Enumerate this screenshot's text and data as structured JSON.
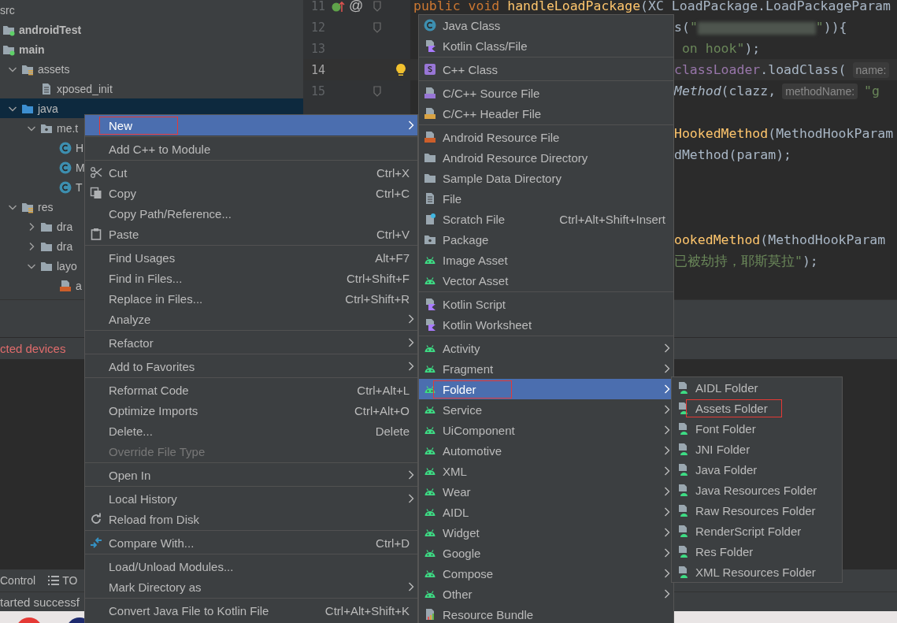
{
  "project_tree": [
    {
      "label": "src",
      "selected": false,
      "children": [
        {
          "label": "androidTest",
          "kind": "module-folder",
          "bold": true,
          "selected": false
        },
        {
          "label": "main",
          "kind": "module-folder",
          "bold": true,
          "selected": false,
          "children": [
            {
              "label": "assets",
              "kind": "resource-folder",
              "expanded": true,
              "selected": false,
              "children": [
                {
                  "label": "xposed_init",
                  "kind": "file",
                  "selected": false
                }
              ]
            },
            {
              "label": "java",
              "kind": "source-folder",
              "expanded": true,
              "selected": true,
              "children": [
                {
                  "label": "me.t",
                  "kind": "package",
                  "expanded": true,
                  "selected": false,
                  "children": [
                    {
                      "label": "H",
                      "kind": "class",
                      "selected": false
                    },
                    {
                      "label": "M",
                      "kind": "class",
                      "selected": false
                    },
                    {
                      "label": "T",
                      "kind": "class",
                      "selected": false
                    }
                  ]
                }
              ]
            },
            {
              "label": "res",
              "kind": "resource-folder",
              "expanded": true,
              "selected": false,
              "children": [
                {
                  "label": "dra",
                  "kind": "folder",
                  "expanded": false,
                  "selected": false
                },
                {
                  "label": "dra",
                  "kind": "folder",
                  "expanded": false,
                  "selected": false
                },
                {
                  "label": "layo",
                  "kind": "folder",
                  "expanded": true,
                  "selected": false,
                  "children": [
                    {
                      "label": "a",
                      "kind": "layout-file",
                      "selected": false
                    }
                  ]
                }
              ]
            }
          ]
        }
      ]
    }
  ],
  "editor": {
    "lines": [
      {
        "kind": "code",
        "number": "11",
        "override_marker": true,
        "gutter_mark": "@",
        "fold": true,
        "segments": [
          {
            "kind": "keyword",
            "text": "public void "
          },
          {
            "kind": "method",
            "text": "handleLoadPackage"
          },
          {
            "kind": "plain",
            "text": "(XC LoadPackage.LoadPackageParam"
          }
        ]
      },
      {
        "kind": "code",
        "number": "12",
        "fold": true,
        "covered": true,
        "segments": [
          {
            "kind": "plain",
            "text": "s("
          },
          {
            "kind": "string",
            "text": "\""
          },
          {
            "kind": "redacted"
          },
          {
            "kind": "string",
            "text": "\""
          },
          {
            "kind": "plain",
            "text": ")){"
          }
        ]
      },
      {
        "kind": "code",
        "number": "13",
        "covered": true,
        "segments": [
          {
            "kind": "string",
            "text": " on hook\""
          },
          {
            "kind": "plain",
            "text": ");"
          }
        ]
      },
      {
        "kind": "code",
        "number": "14",
        "current": true,
        "bulb": true,
        "covered": true,
        "segments": [
          {
            "kind": "field",
            "text": "classLoader"
          },
          {
            "kind": "plain",
            "text": ".loadClass("
          },
          {
            "kind": "hint",
            "text": "name:"
          }
        ]
      },
      {
        "kind": "code",
        "number": "15",
        "fold": true,
        "covered": true,
        "segments": [
          {
            "kind": "italic",
            "text": "Method"
          },
          {
            "kind": "plain",
            "text": "(clazz,"
          },
          {
            "kind": "hint",
            "text": "methodName:"
          },
          {
            "kind": "string",
            "text": "\"g"
          }
        ]
      },
      {
        "kind": "blank"
      },
      {
        "kind": "code",
        "covered": true,
        "segments": [
          {
            "kind": "method",
            "text": "HookedMethod"
          },
          {
            "kind": "plain",
            "text": "(MethodHookParam"
          }
        ]
      },
      {
        "kind": "code",
        "covered": true,
        "segments": [
          {
            "kind": "plain",
            "text": "dMethod(param);"
          }
        ]
      },
      {
        "kind": "blank"
      },
      {
        "kind": "blank"
      },
      {
        "kind": "blank"
      },
      {
        "kind": "code",
        "covered": true,
        "segments": [
          {
            "kind": "method",
            "text": "ookedMethod"
          },
          {
            "kind": "plain",
            "text": "(MethodHookParam"
          }
        ]
      },
      {
        "kind": "code",
        "covered": true,
        "segments": [
          {
            "kind": "string",
            "text": "已被劫持，耶斯莫拉\""
          },
          {
            "kind": "plain",
            "text": ");"
          }
        ]
      }
    ]
  },
  "run_panel": {
    "error_text": "cted devices"
  },
  "tool_strip": {
    "tabs": [
      {
        "label": "Control",
        "kind": "plain"
      },
      {
        "label": "TO",
        "kind": "list"
      }
    ]
  },
  "status_bar": {
    "text": "tarted successf"
  },
  "taskbar": {
    "apps": [
      {
        "color": "#e53935"
      },
      {
        "color": "#1e2a6e"
      }
    ]
  },
  "context_menu": {
    "items": [
      {
        "kind": "plain",
        "label": "New",
        "submenu": true,
        "selected": true,
        "marked": true
      },
      {
        "kind": "separator"
      },
      {
        "kind": "plain",
        "label": "Add C++ to Module",
        "selected": false
      },
      {
        "kind": "separator"
      },
      {
        "kind": "scissors",
        "label": "Cut",
        "shortcut": "Ctrl+X",
        "selected": false
      },
      {
        "kind": "copy",
        "label": "Copy",
        "shortcut": "Ctrl+C",
        "selected": false
      },
      {
        "kind": "plain",
        "label": "Copy Path/Reference...",
        "selected": false
      },
      {
        "kind": "paste",
        "label": "Paste",
        "shortcut": "Ctrl+V",
        "selected": false
      },
      {
        "kind": "separator"
      },
      {
        "kind": "plain",
        "label": "Find Usages",
        "shortcut": "Alt+F7",
        "selected": false
      },
      {
        "kind": "plain",
        "label": "Find in Files...",
        "shortcut": "Ctrl+Shift+F",
        "selected": false
      },
      {
        "kind": "plain",
        "label": "Replace in Files...",
        "shortcut": "Ctrl+Shift+R",
        "selected": false
      },
      {
        "kind": "plain",
        "label": "Analyze",
        "submenu": true,
        "selected": false
      },
      {
        "kind": "separator"
      },
      {
        "kind": "plain",
        "label": "Refactor",
        "submenu": true,
        "selected": false
      },
      {
        "kind": "separator"
      },
      {
        "kind": "plain",
        "label": "Add to Favorites",
        "submenu": true,
        "selected": false
      },
      {
        "kind": "separator"
      },
      {
        "kind": "plain",
        "label": "Reformat Code",
        "shortcut": "Ctrl+Alt+L",
        "selected": false
      },
      {
        "kind": "plain",
        "label": "Optimize Imports",
        "shortcut": "Ctrl+Alt+O",
        "selected": false
      },
      {
        "kind": "plain",
        "label": "Delete...",
        "shortcut": "Delete",
        "selected": false
      },
      {
        "kind": "plain",
        "label": "Override File Type",
        "disabled": true,
        "selected": false
      },
      {
        "kind": "separator"
      },
      {
        "kind": "plain",
        "label": "Open In",
        "submenu": true,
        "selected": false
      },
      {
        "kind": "separator"
      },
      {
        "kind": "plain",
        "label": "Local History",
        "submenu": true,
        "selected": false
      },
      {
        "kind": "reload",
        "label": "Reload from Disk",
        "selected": false
      },
      {
        "kind": "separator"
      },
      {
        "kind": "compare",
        "label": "Compare With...",
        "shortcut": "Ctrl+D",
        "selected": false
      },
      {
        "kind": "separator"
      },
      {
        "kind": "plain",
        "label": "Load/Unload Modules...",
        "selected": false
      },
      {
        "kind": "plain",
        "label": "Mark Directory as",
        "submenu": true,
        "selected": false
      },
      {
        "kind": "separator"
      },
      {
        "kind": "plain",
        "label": "Convert Java File to Kotlin File",
        "shortcut": "Ctrl+Alt+Shift+K",
        "selected": false
      }
    ]
  },
  "new_submenu": {
    "items": [
      {
        "kind": "class",
        "label": "Java Class",
        "selected": false
      },
      {
        "kind": "kotlin",
        "label": "Kotlin Class/File",
        "selected": false
      },
      {
        "kind": "separator"
      },
      {
        "kind": "cpp-class",
        "label": "C++ Class",
        "selected": false
      },
      {
        "kind": "separator"
      },
      {
        "kind": "cpp-source",
        "label": "C/C++ Source File",
        "selected": false
      },
      {
        "kind": "cpp-header",
        "label": "C/C++ Header File",
        "selected": false
      },
      {
        "kind": "separator"
      },
      {
        "kind": "resource-file",
        "label": "Android Resource File",
        "selected": false
      },
      {
        "kind": "folder",
        "label": "Android Resource Directory",
        "selected": false
      },
      {
        "kind": "folder",
        "label": "Sample Data Directory",
        "selected": false
      },
      {
        "kind": "file",
        "label": "File",
        "selected": false
      },
      {
        "kind": "scratch",
        "label": "Scratch File",
        "shortcut": "Ctrl+Alt+Shift+Insert",
        "selected": false
      },
      {
        "kind": "package",
        "label": "Package",
        "selected": false
      },
      {
        "kind": "android",
        "label": "Image Asset",
        "selected": false
      },
      {
        "kind": "android",
        "label": "Vector Asset",
        "selected": false
      },
      {
        "kind": "separator"
      },
      {
        "kind": "kotlin",
        "label": "Kotlin Script",
        "selected": false
      },
      {
        "kind": "kotlin",
        "label": "Kotlin Worksheet",
        "selected": false
      },
      {
        "kind": "separator"
      },
      {
        "kind": "android",
        "label": "Activity",
        "submenu": true,
        "selected": false
      },
      {
        "kind": "android",
        "label": "Fragment",
        "submenu": true,
        "selected": false
      },
      {
        "kind": "android",
        "label": "Folder",
        "submenu": true,
        "selected": true,
        "marked": true
      },
      {
        "kind": "android",
        "label": "Service",
        "submenu": true,
        "selected": false
      },
      {
        "kind": "android",
        "label": "UiComponent",
        "submenu": true,
        "selected": false
      },
      {
        "kind": "android",
        "label": "Automotive",
        "submenu": true,
        "selected": false
      },
      {
        "kind": "android",
        "label": "XML",
        "submenu": true,
        "selected": false
      },
      {
        "kind": "android",
        "label": "Wear",
        "submenu": true,
        "selected": false
      },
      {
        "kind": "android",
        "label": "AIDL",
        "submenu": true,
        "selected": false
      },
      {
        "kind": "android",
        "label": "Widget",
        "submenu": true,
        "selected": false
      },
      {
        "kind": "android",
        "label": "Google",
        "submenu": true,
        "selected": false
      },
      {
        "kind": "android",
        "label": "Compose",
        "submenu": true,
        "selected": false
      },
      {
        "kind": "android",
        "label": "Other",
        "submenu": true,
        "selected": false
      },
      {
        "kind": "bundle",
        "label": "Resource Bundle",
        "selected": false
      }
    ]
  },
  "folder_submenu": {
    "items": [
      {
        "kind": "android-file",
        "label": "AIDL Folder",
        "selected": false
      },
      {
        "kind": "android-file",
        "label": "Assets Folder",
        "selected": false,
        "marked": true
      },
      {
        "kind": "android-file",
        "label": "Font Folder",
        "selected": false
      },
      {
        "kind": "android-file",
        "label": "JNI Folder",
        "selected": false
      },
      {
        "kind": "android-file",
        "label": "Java Folder",
        "selected": false
      },
      {
        "kind": "android-file",
        "label": "Java Resources Folder",
        "selected": false
      },
      {
        "kind": "android-file",
        "label": "Raw Resources Folder",
        "selected": false
      },
      {
        "kind": "android-file",
        "label": "RenderScript Folder",
        "selected": false
      },
      {
        "kind": "android-file",
        "label": "Res Folder",
        "selected": false
      },
      {
        "kind": "android-file",
        "label": "XML Resources Folder",
        "selected": false
      }
    ]
  }
}
